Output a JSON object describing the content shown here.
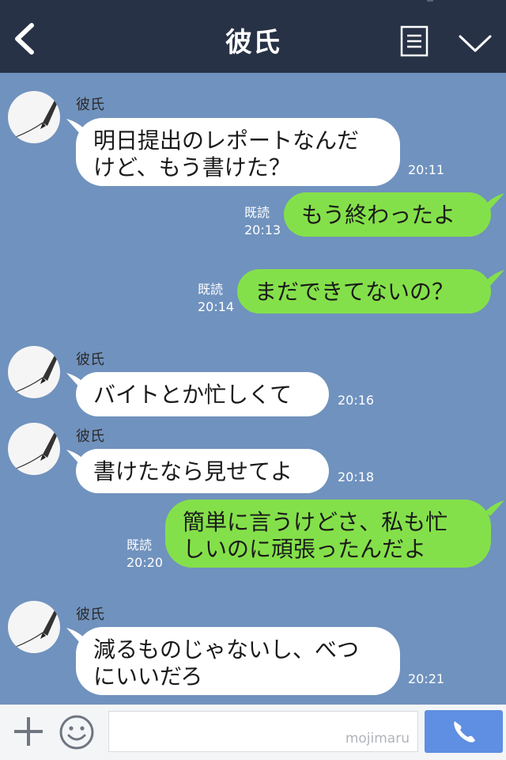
{
  "header": {
    "title": "彼氏"
  },
  "messages": [
    {
      "sender": "彼氏",
      "lines": [
        "明日提出のレポートなんだ",
        "けど、もう書けた？"
      ],
      "time": "20:11"
    },
    {
      "lines": [
        "もう終わったよ"
      ],
      "read": "既読",
      "time": "20:13"
    },
    {
      "lines": [
        "まだできてないの？"
      ],
      "read": "既読",
      "time": "20:14"
    },
    {
      "sender": "彼氏",
      "lines": [
        "バイトとか忙しくて"
      ],
      "time": "20:16"
    },
    {
      "sender": "彼氏",
      "lines": [
        "書けたなら見せてよ"
      ],
      "time": "20:18"
    },
    {
      "lines": [
        "簡単に言うけどさ、私も忙",
        "しいのに頑張ったんだよ"
      ],
      "read": "既読",
      "time": "20:20"
    },
    {
      "sender": "彼氏",
      "lines": [
        "減るものじゃないし、べつ",
        "にいいだろ"
      ],
      "time": "20:21"
    }
  ],
  "footer": {
    "watermark": "mojimaru"
  },
  "colors": {
    "header": "#273246",
    "chat_bg": "#7092be",
    "outgoing": "#84e04a",
    "incoming": "#ffffff",
    "send": "#5e8fe2"
  },
  "icons": [
    "back-arrow-icon",
    "notes-icon",
    "chevron-down-icon",
    "fountain-pen-icon",
    "plus-icon",
    "smiley-icon",
    "phone-icon"
  ]
}
